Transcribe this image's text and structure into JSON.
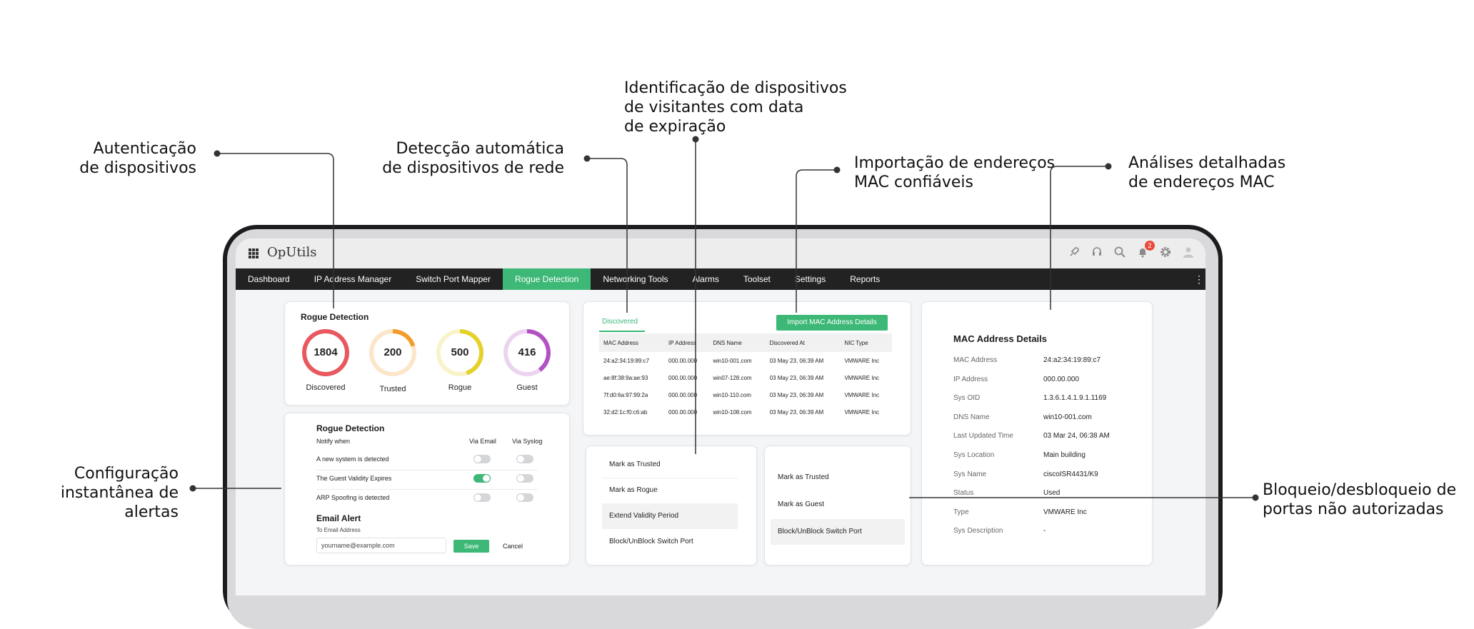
{
  "callouts": {
    "autenticacao": [
      "Autenticação",
      "de dispositivos"
    ],
    "deteccao": [
      "Detecção automática",
      "de dispositivos de rede"
    ],
    "identificacao": [
      "Identificação de dispositivos",
      "de visitantes com data",
      "de expiração"
    ],
    "importacao": [
      "Importação de endereços",
      "MAC confiáveis"
    ],
    "analises": [
      "Análises detalhadas",
      "de endereços MAC"
    ],
    "configuracao": [
      "Configuração",
      "instantânea de",
      "alertas"
    ],
    "bloqueio": [
      "Bloqueio/desbloqueio de",
      "portas não autorizadas"
    ]
  },
  "app": {
    "title": "OpUtils",
    "notification_count": "2",
    "icons": [
      "apps-grid-icon",
      "rocket-icon",
      "headset-icon",
      "search-icon",
      "bell-icon",
      "gear-icon",
      "user-avatar-icon",
      "more-vertical-icon"
    ]
  },
  "nav": {
    "items": [
      "Dashboard",
      "IP Address Manager",
      "Switch Port Mapper",
      "Rogue Detection",
      "Networking Tools",
      "Alarms",
      "Toolset",
      "Settings",
      "Reports"
    ],
    "active": "Rogue Detection"
  },
  "rogue_summary": {
    "title": "Rogue Detection",
    "rings": [
      {
        "value": "1804",
        "label": "Discovered",
        "color": "#e8585f",
        "fill": 1.0
      },
      {
        "value": "200",
        "label": "Trusted",
        "color": "#f39c2b",
        "fill": 0.2
      },
      {
        "value": "500",
        "label": "Rogue",
        "color": "#e5d12b",
        "fill": 0.45
      },
      {
        "value": "416",
        "label": "Guest",
        "color": "#b252c3",
        "fill": 0.4
      }
    ]
  },
  "alerts": {
    "title": "Rogue Detection",
    "notify_when": "Notify when",
    "via_email": "Via Email",
    "via_syslog": "Via Syslog",
    "rows": [
      {
        "label": "A new system is detected",
        "email": false,
        "syslog": false
      },
      {
        "label": "The Guest Validity Expires",
        "email": true,
        "syslog": false
      },
      {
        "label": "ARP Spoofing is detected",
        "email": false,
        "syslog": false
      }
    ],
    "email_alert": "Email Alert",
    "to_email_label": "To Email Address",
    "email_placeholder": "yourname@example.com",
    "save": "Save",
    "cancel": "Cancel"
  },
  "discovered": {
    "tab": "Discovered",
    "import_button": "Import MAC Address Details",
    "columns": [
      "MAC Address",
      "IP Address",
      "DNS Name",
      "Discovered At",
      "NIC Type"
    ],
    "rows": [
      [
        "24:a2:34:19:89:c7",
        "000.00.000",
        "win10-001.com",
        "03 May 23, 06:39 AM",
        "VMWARE Inc"
      ],
      [
        "ae:8f:38:9a:ae:93",
        "000.00.000",
        "win07-128.com",
        "03 May 23, 06:39 AM",
        "VMWARE Inc"
      ],
      [
        "7f:d0:6a:97:99:2a",
        "000.00.000",
        "win10-110.com",
        "03 May 23, 06:39 AM",
        "VMWARE Inc"
      ],
      [
        "32:d2:1c:f0:c6:ab",
        "000.00.000",
        "win10-108.com",
        "03 May 23, 06:39 AM",
        "VMWARE Inc"
      ]
    ]
  },
  "menu_left": {
    "items": [
      "Mark as Trusted",
      "Mark as Rogue",
      "Extend Validity Period",
      "Block/UnBlock Switch Port"
    ]
  },
  "menu_right": {
    "items": [
      "Mark as Trusted",
      "Mark as Guest",
      "Block/UnBlock Switch Port"
    ]
  },
  "mac_details": {
    "title": "MAC Address Details",
    "rows": [
      {
        "key": "MAC Address",
        "value": "24:a2:34:19:89:c7"
      },
      {
        "key": "IP Address",
        "value": "000.00.000"
      },
      {
        "key": "Sys OID",
        "value": "1.3.6.1.4.1.9.1.1169"
      },
      {
        "key": "DNS Name",
        "value": "win10-001.com"
      },
      {
        "key": "Last Updated Time",
        "value": "03 Mar 24, 06:38 AM"
      },
      {
        "key": "Sys Location",
        "value": "Main building"
      },
      {
        "key": "Sys Name",
        "value": "ciscoISR4431/K9"
      },
      {
        "key": "Status",
        "value": "Used"
      },
      {
        "key": "Type",
        "value": "VMWARE Inc"
      },
      {
        "key": "Sys Description",
        "value": "-"
      }
    ]
  }
}
